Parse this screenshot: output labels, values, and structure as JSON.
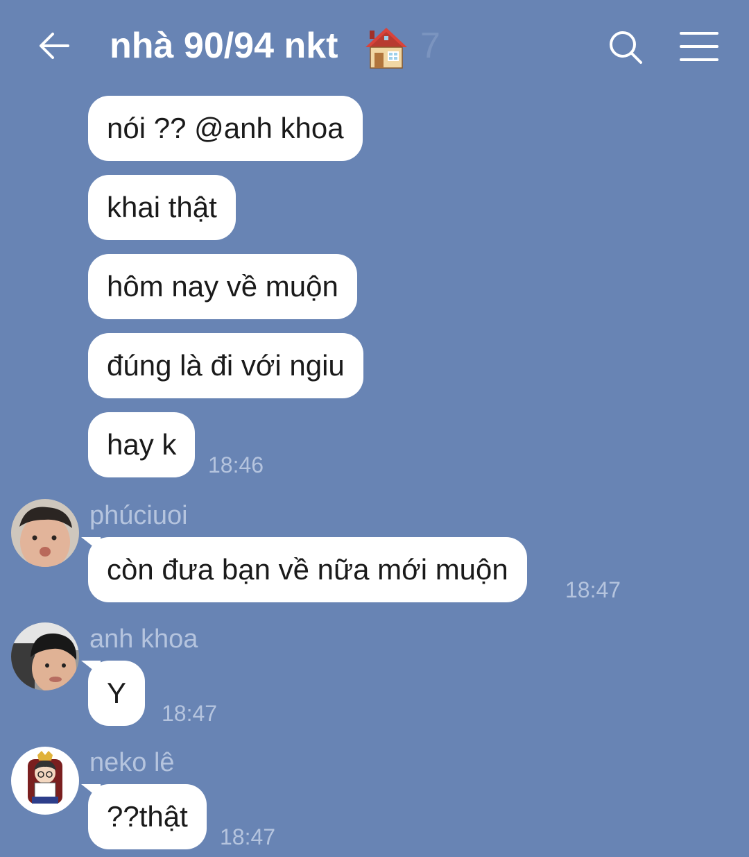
{
  "header": {
    "title": "nhà 90/94 nkt",
    "member_count": "7",
    "back_icon": "arrow-left-icon",
    "title_emoji": "house-icon",
    "search_icon": "search-icon",
    "menu_icon": "menu-icon"
  },
  "messages": [
    {
      "text": "nói ?? @anh khoa"
    },
    {
      "text": "khai thật"
    },
    {
      "text": "hôm nay về muộn"
    },
    {
      "text": "đúng là đi với ngiu"
    },
    {
      "text": "hay k",
      "time": "18:46"
    },
    {
      "sender": "phúciuoi",
      "text": "còn đưa bạn về nữa mới muộn",
      "time": "18:47"
    },
    {
      "sender": "anh khoa",
      "text": "Y",
      "time": "18:47"
    },
    {
      "sender": "neko lê",
      "text": "??thật",
      "time": "18:47"
    }
  ],
  "colors": {
    "background": "#6884b4",
    "bubble": "#ffffff",
    "meta_text": "#b5c4de"
  }
}
